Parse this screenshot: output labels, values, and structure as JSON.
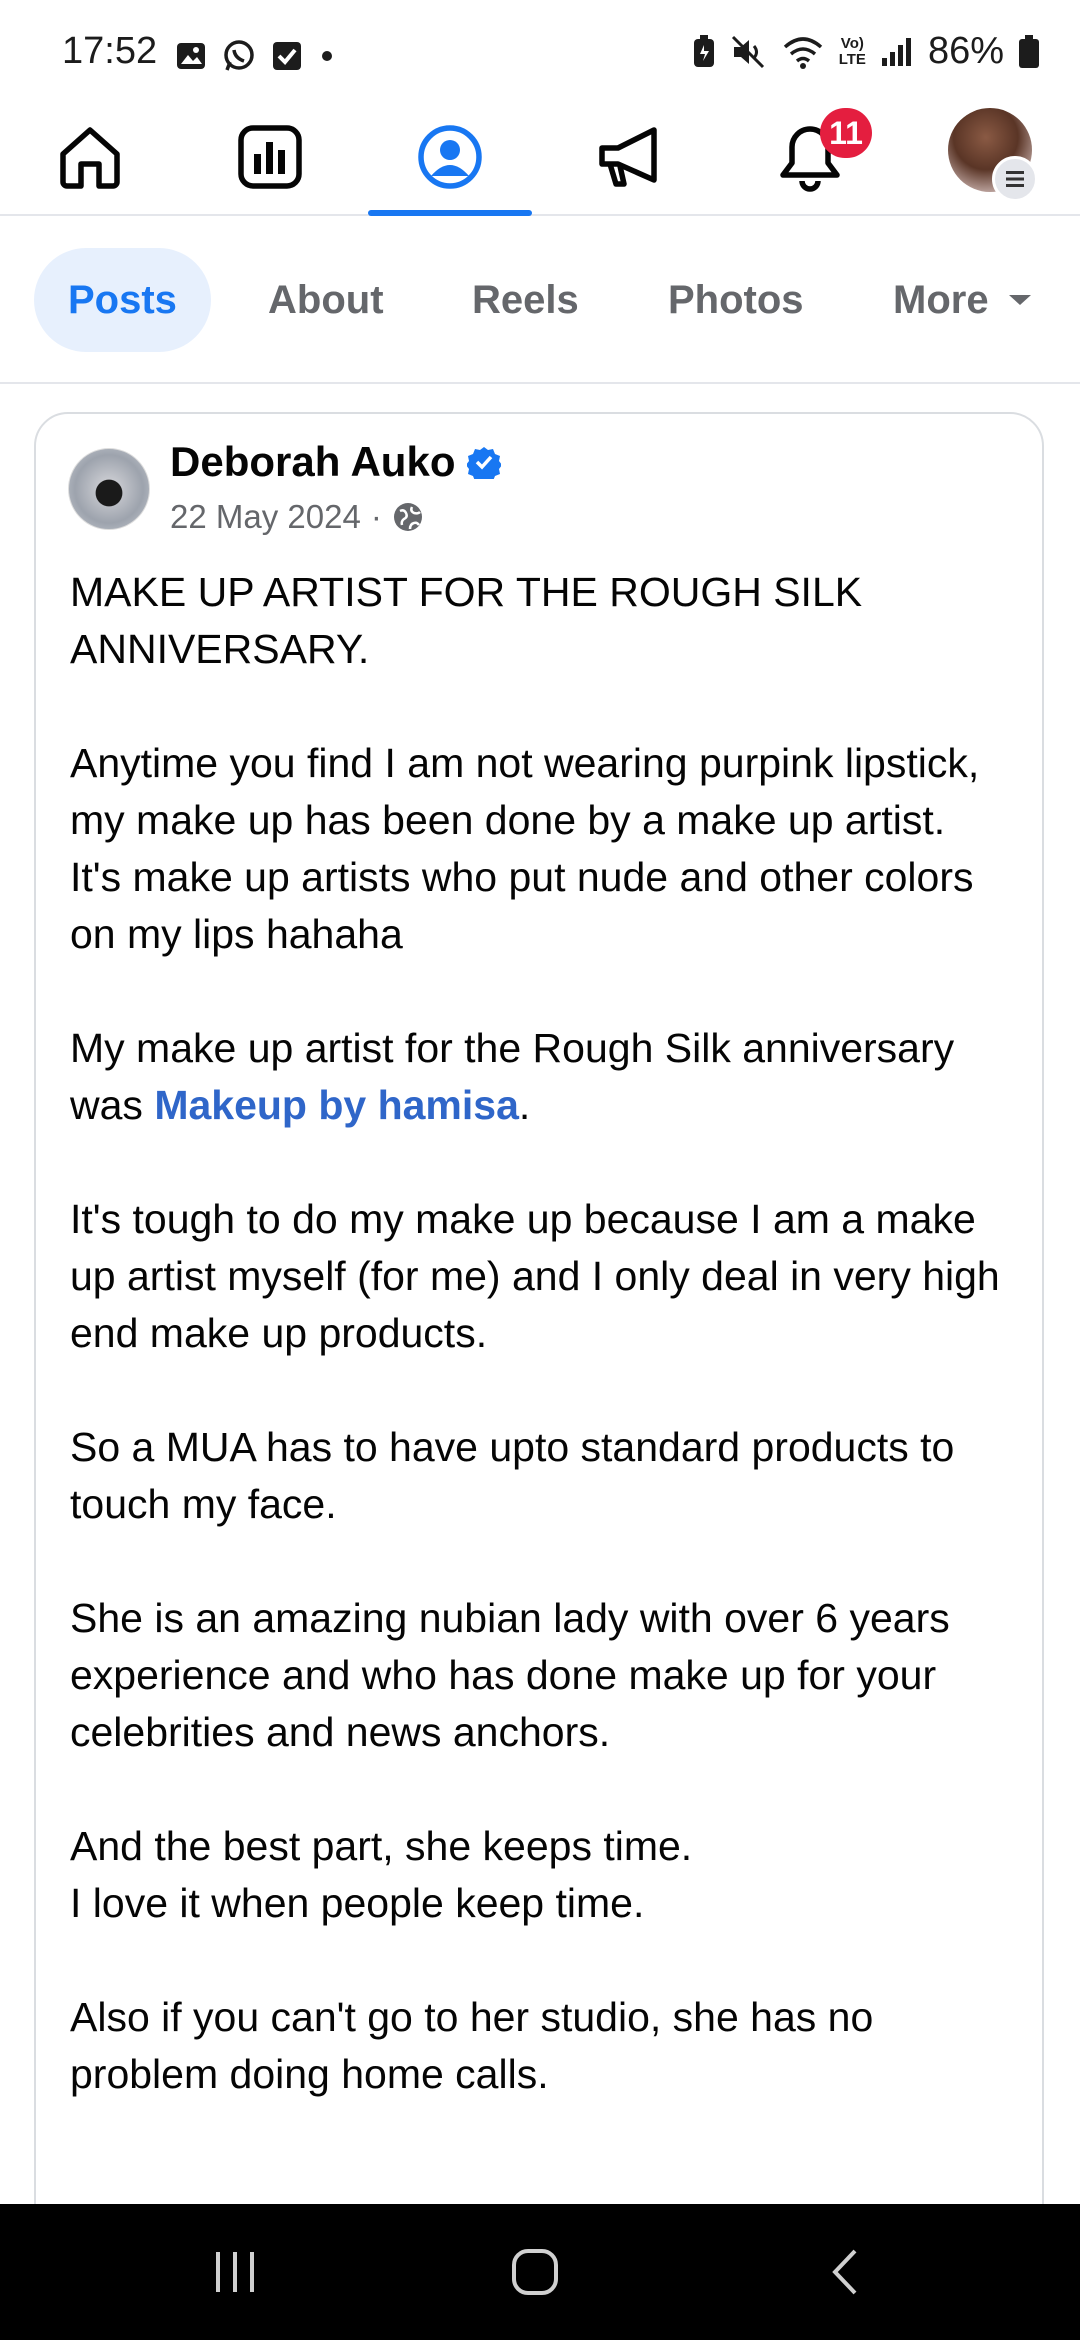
{
  "status_bar": {
    "time": "17:52",
    "battery_percent": "86%",
    "lte_label_top": "Vo)",
    "lte_label_bottom": "LTE"
  },
  "top_nav": {
    "items": [
      "home",
      "dashboard",
      "profile",
      "ads",
      "notifications",
      "menu"
    ],
    "active": "profile",
    "notification_count": "11",
    "accent_color": "#1877f2",
    "badge_color": "#e41e3f"
  },
  "tabs": [
    {
      "label": "Posts",
      "active": true
    },
    {
      "label": "About",
      "active": false
    },
    {
      "label": "Reels",
      "active": false
    },
    {
      "label": "Photos",
      "active": false
    },
    {
      "label": "More",
      "active": false
    }
  ],
  "post": {
    "author": "Deborah Auko",
    "verified": true,
    "date": "22 May 2024",
    "separator": "·",
    "audience": "public",
    "paragraphs": {
      "p1": "MAKE UP ARTIST FOR THE ROUGH SILK ANNIVERSARY.",
      "p2a": "Anytime you find I am not wearing purpink lipstick, my make up has been done by a make up artist.",
      "p2b": "It's make up artists who put nude and other colors on my lips hahaha",
      "p3_prefix": "My make up artist for the Rough Silk anniversary was ",
      "p3_mention": "Makeup by hamisa",
      "p3_suffix": ".",
      "p4": "It's tough to do my make up because I am a make up artist myself (for me) and I only deal in very high end make up products.",
      "p5": "So a MUA has to have upto standard products to touch my face.",
      "p6": "She is an amazing nubian lady with over 6 years experience and who has done make up for your celebrities and news anchors.",
      "p7a": "And the best part, she keeps time.",
      "p7b": "I love it when people keep time.",
      "p8": "Also if you can't go to her studio, she has no problem doing home calls."
    }
  },
  "system_nav": [
    "recents",
    "home",
    "back"
  ]
}
